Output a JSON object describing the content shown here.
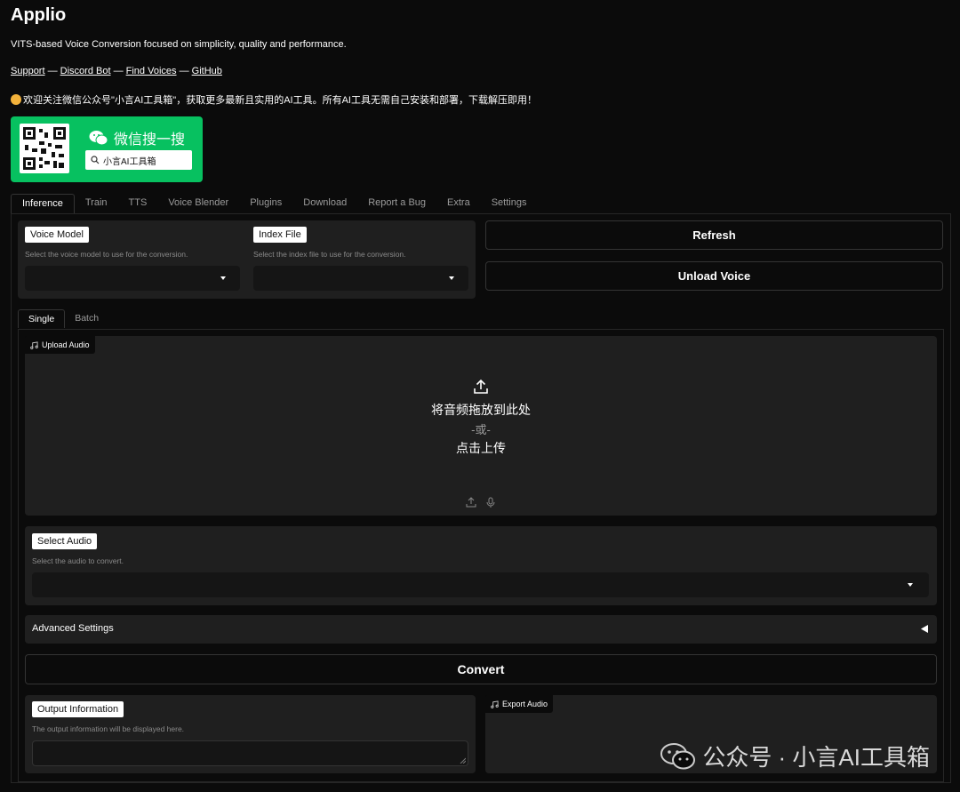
{
  "app": {
    "title": "Applio",
    "subtitle": "VITS-based Voice Conversion focused on simplicity, quality and performance.",
    "links": [
      "Support",
      "Discord Bot",
      "Find Voices",
      "GitHub"
    ],
    "link_separator": "—",
    "notice": "欢迎关注微信公众号\"小言AI工具箱\"，获取更多最新且实用的AI工具。所有AI工具无需自己安装和部署，下载解压即用！"
  },
  "promo": {
    "title": "微信搜一搜",
    "search_text": "小言AI工具箱",
    "color": "#07c160"
  },
  "tabs": [
    "Inference",
    "Train",
    "TTS",
    "Voice Blender",
    "Plugins",
    "Download",
    "Report a Bug",
    "Extra",
    "Settings"
  ],
  "active_tab": "Inference",
  "inference": {
    "voice_model": {
      "label": "Voice Model",
      "hint": "Select the voice model to use for the conversion.",
      "value": ""
    },
    "index_file": {
      "label": "Index File",
      "hint": "Select the index file to use for the conversion.",
      "value": ""
    },
    "refresh_label": "Refresh",
    "unload_label": "Unload Voice",
    "subtabs": [
      "Single",
      "Batch"
    ],
    "upload": {
      "label": "Upload Audio",
      "drop_text": "将音频拖放到此处",
      "or_text": "-或-",
      "click_text": "点击上传"
    },
    "select_audio": {
      "label": "Select Audio",
      "hint": "Select the audio to convert.",
      "value": ""
    },
    "advanced_label": "Advanced Settings",
    "convert_label": "Convert",
    "output_info": {
      "label": "Output Information",
      "hint": "The output information will be displayed here.",
      "value": ""
    },
    "export_audio_label": "Export Audio"
  },
  "watermark": "公众号 · 小言AI工具箱"
}
